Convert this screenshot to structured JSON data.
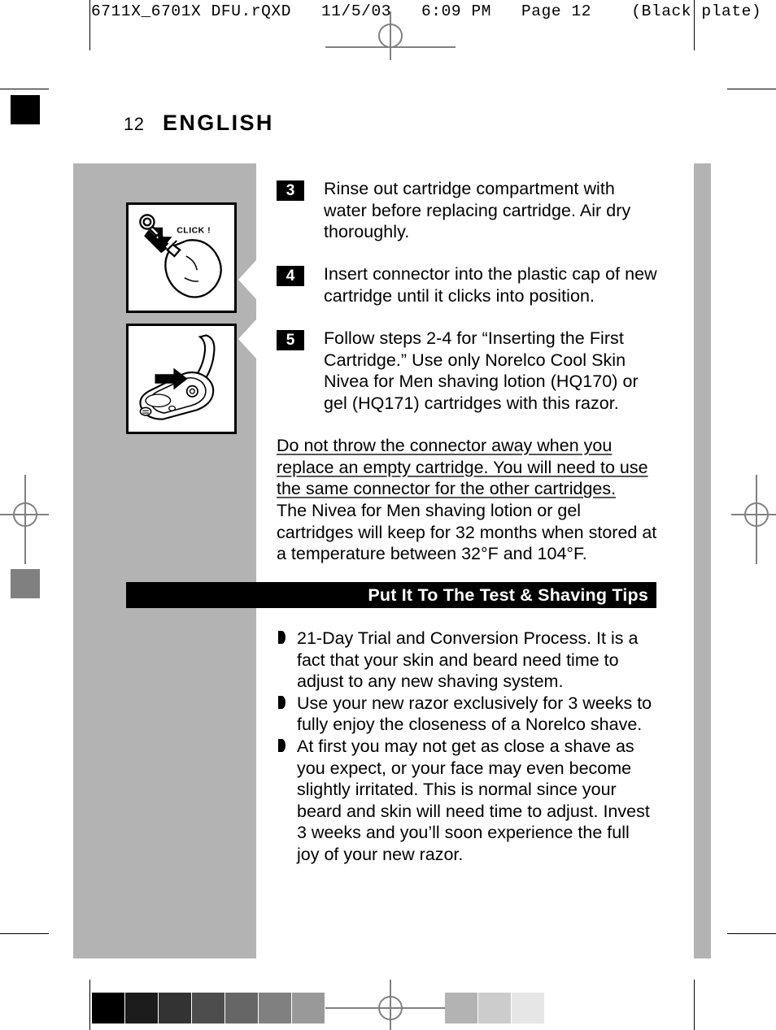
{
  "prepress": {
    "header_text": "6711X_6701X DFU.rQXD   11/5/03   6:09 PM   Page 12    (Black plate)"
  },
  "page": {
    "number": "12",
    "language": "ENGLISH"
  },
  "steps": [
    {
      "number": "3",
      "text": "Rinse out cartridge compartment with water before replacing cartridge. Air dry thoroughly."
    },
    {
      "number": "4",
      "text": "Insert connector into the plastic cap of new cartridge until it clicks into position."
    },
    {
      "number": "5",
      "text": "Follow steps 2-4 for “Inserting the First Cartridge.” Use only Norelco Cool Skin Nivea for Men shaving lotion (HQ170) or gel (HQ171) cartridges with this razor."
    }
  ],
  "notice": {
    "underlined": "Do not throw the connector away when you replace an empty cartridge. You will need to use the same connector for the other cartridges.",
    "plain": "The Nivea for Men shaving lotion or gel cartridges will keep for 32 months when stored at a temperature between 32°F and 104°F."
  },
  "section": {
    "title": "Put It To The Test & Shaving Tips"
  },
  "tips": [
    "21-Day Trial and Conversion Process. It is a fact that your skin and beard need time to adjust to any new shaving system.",
    "Use your new razor exclusively for 3 weeks to fully enjoy the closeness of a Norelco shave.",
    "At first you may not get as close a shave as you expect, or your face may even become slightly irritated. This is normal since your beard and skin will need time to adjust. Invest 3 weeks and you’ll soon experience the full joy of your new razor."
  ],
  "illustrations": [
    {
      "name": "connector-click-into-cartridge",
      "caption": "CLICK !"
    },
    {
      "name": "razor-lid-open-insert-cartridge",
      "caption": ""
    }
  ],
  "calibration": {
    "left_swatches": [
      "#000000",
      "#1c1c1c",
      "#333333",
      "#4d4d4d",
      "#666666",
      "#808080",
      "#999999"
    ],
    "right_swatches": [
      "#b3b3b3",
      "#cccccc",
      "#e6e6e6"
    ]
  },
  "colors": {
    "panel_gray": "#b3b3b3",
    "bar_black": "#000000",
    "bar_text": "#ffffff",
    "mark_gray": "#808080"
  }
}
